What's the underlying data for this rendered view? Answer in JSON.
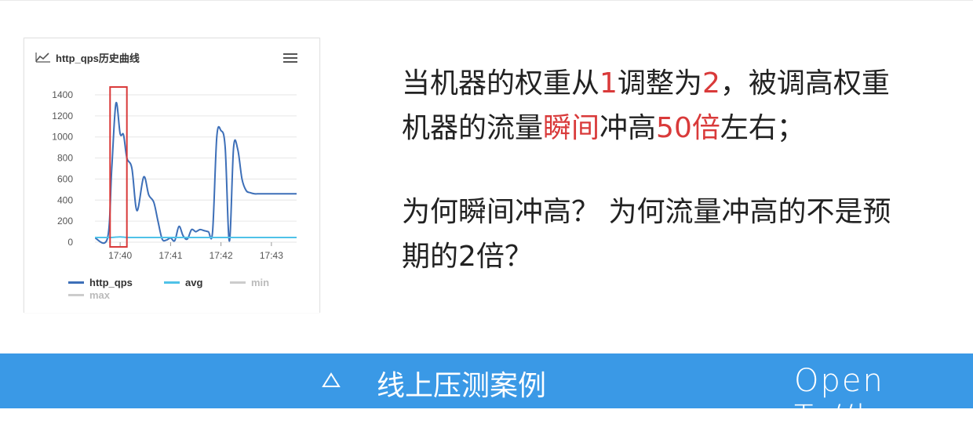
{
  "chart_panel": {
    "title": "http_qps历史曲线",
    "icon": "trend-icon",
    "menu_icon": "hamburger-menu-icon"
  },
  "chart_data": {
    "type": "line",
    "title": "http_qps历史曲线",
    "x": [
      "17:39:30",
      "17:39:45",
      "17:39:50",
      "17:39:55",
      "17:40:00",
      "17:40:04",
      "17:40:08",
      "17:40:14",
      "17:40:20",
      "17:40:28",
      "17:40:34",
      "17:40:40",
      "17:40:45",
      "17:40:50",
      "17:40:55",
      "17:41:00",
      "17:41:05",
      "17:41:10",
      "17:41:15",
      "17:41:20",
      "17:41:25",
      "17:41:30",
      "17:41:35",
      "17:41:40",
      "17:41:45",
      "17:41:50",
      "17:41:55",
      "17:42:00",
      "17:42:05",
      "17:42:10",
      "17:42:15",
      "17:42:20",
      "17:42:25",
      "17:42:30",
      "17:42:35",
      "17:42:40",
      "17:42:45",
      "17:42:50",
      "17:42:55",
      "17:43:00",
      "17:43:05",
      "17:43:10",
      "17:43:15",
      "17:43:20",
      "17:43:25",
      "17:43:30"
    ],
    "xticks": [
      "17:40",
      "17:41",
      "17:42",
      "17:43"
    ],
    "ylim": [
      0,
      1400
    ],
    "yticks": [
      0,
      200,
      400,
      600,
      800,
      1000,
      1200,
      1400
    ],
    "grid": true,
    "legend_position": "bottom",
    "highlight_box": {
      "x_from": "17:39:48",
      "x_to": "17:40:08"
    },
    "series": [
      {
        "name": "http_qps",
        "color": "#3d6fb8",
        "values": [
          40,
          40,
          700,
          1320,
          1030,
          1020,
          800,
          700,
          300,
          620,
          450,
          380,
          200,
          30,
          20,
          40,
          15,
          150,
          60,
          30,
          120,
          100,
          120,
          110,
          100,
          100,
          1000,
          1060,
          900,
          10,
          900,
          880,
          600,
          490,
          470,
          460,
          460,
          460,
          460,
          460,
          460,
          460,
          460,
          460,
          460,
          460
        ]
      },
      {
        "name": "avg",
        "color": "#4fc2e8",
        "values": [
          45,
          45,
          45,
          48,
          50,
          48,
          45,
          45,
          45,
          45,
          45,
          45,
          45,
          45,
          45,
          45,
          45,
          45,
          45,
          45,
          45,
          45,
          45,
          45,
          45,
          45,
          45,
          45,
          45,
          45,
          45,
          45,
          45,
          45,
          45,
          45,
          45,
          45,
          45,
          45,
          45,
          45,
          45,
          45,
          45,
          45
        ]
      },
      {
        "name": "min",
        "color": "#cccccc",
        "values": []
      },
      {
        "name": "max",
        "color": "#cccccc",
        "values": []
      }
    ]
  },
  "text_lines": {
    "l1_a": "当机器的权重从",
    "l1_b": "1",
    "l1_c": "调整为",
    "l1_d": "2",
    "l1_e": "，被调高权重",
    "l2_a": "机器的流量",
    "l2_b": "瞬间",
    "l2_c": "冲高",
    "l2_d": "50倍",
    "l2_e": "左右；",
    "l3": "为何瞬间冲高？  为何流量冲高的不是预",
    "l4": "期的2倍？"
  },
  "colors": {
    "highlight": "#d93a3a",
    "footer_bg": "#3a99e6",
    "text": "#222222"
  },
  "footer": {
    "icon": "triangle-icon",
    "title": "线上压测案例",
    "brand": "Open Ta//k"
  }
}
